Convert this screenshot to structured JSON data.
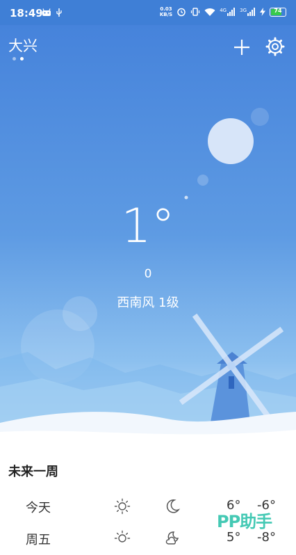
{
  "status_bar": {
    "time": "18:49",
    "net_speed_value": "0.03",
    "net_speed_unit": "KB/S",
    "signal1_label": "4G",
    "signal2_label": "3G",
    "battery": "74",
    "battery_level": 0.74
  },
  "header": {
    "city": "大兴",
    "pages": 2,
    "active_page": 1
  },
  "current": {
    "temperature": "1°",
    "value": "0",
    "wind": "西南风 1级"
  },
  "week": {
    "title": "未来一周",
    "days": [
      {
        "label": "今天",
        "day_icon": "sun-icon",
        "night_icon": "moon-icon",
        "high": "6°",
        "low": "-6°"
      },
      {
        "label": "周五",
        "day_icon": "sun-icon",
        "night_icon": "cloudy-moon-icon",
        "high": "5°",
        "low": "-8°"
      }
    ]
  },
  "watermark": "PP助手",
  "colors": {
    "sky_top": "#4683db",
    "sky_bottom": "#cde6f8",
    "battery_green": "#38c94a",
    "watermark": "#44c9b4"
  }
}
